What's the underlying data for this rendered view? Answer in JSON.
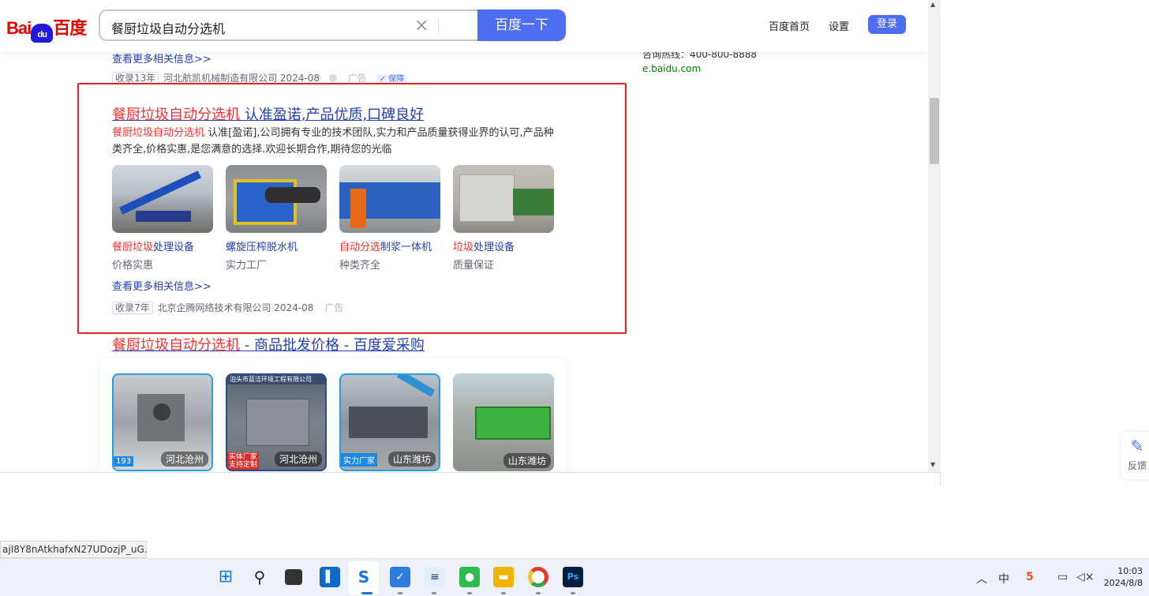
{
  "header": {
    "logo_text_left": "Bai",
    "logo_paw": "du",
    "logo_text_right": "百度",
    "search_query": "餐厨垃圾自动分选机",
    "search_button": "百度一下",
    "nav_home": "百度首页",
    "nav_settings": "设置",
    "login": "登录"
  },
  "prev_result": {
    "more_link": "查看更多相关信息>>",
    "tag": "收录13年",
    "company": "河北航凯机械制造有限公司 2024-08",
    "ad": "广告",
    "protect": "保障"
  },
  "right_column": {
    "hotline": "咨询热线：400-800-8888",
    "site": "e.baidu.com"
  },
  "ad_result": {
    "title_hl": "餐厨垃圾自动分选机",
    "title_rest": " 认准盈诺,产品优质,口碑良好",
    "desc_hl": "餐厨垃圾自动分选机",
    "desc_rest": " 认准[盈诺],公司拥有专业的技术团队,实力和产品质量获得业界的认可,产品种类齐全,价格实惠,是您满意的选择.欢迎长期合作,期待您的光临",
    "items": [
      {
        "title_hl": "餐厨垃圾",
        "title_rest": "处理设备",
        "sub": "价格实惠"
      },
      {
        "title_hl": "",
        "title_rest": "螺旋压榨脱水机",
        "sub": "实力工厂"
      },
      {
        "title_hl": "自动分选",
        "title_rest": "制浆一体机",
        "sub": "种类齐全"
      },
      {
        "title_hl": "垃圾",
        "title_rest": "处理设备",
        "sub": "质量保证"
      }
    ],
    "more_link": "查看更多相关信息>>",
    "tag": "收录7年",
    "company": "北京企腾网络技术有限公司 2024-08",
    "ad": "广告"
  },
  "b2b_result": {
    "title_hl": "餐厨垃圾自动分选机",
    "title_rest": " - 商品批发价格 - 百度爱采购",
    "products": [
      {
        "location": "河北沧州",
        "band": "",
        "label": "193"
      },
      {
        "location": "河北沧州",
        "band": "泊头市蓝洁环境工程有限公司",
        "label": "实体厂家 支持定制"
      },
      {
        "location": "山东潍坊",
        "band": "",
        "label": "实力厂家"
      },
      {
        "location": "山东潍坊",
        "band": "",
        "label": ""
      }
    ]
  },
  "feedback_label": "反馈",
  "status_url": "ajI8Y8nAtkhafxN27UDozjP_uG...",
  "taskbar": {
    "time": "10:03",
    "date": "2024/8/8",
    "ime": "中"
  },
  "colors": {
    "brand_blue": "#4e6ef2",
    "link_blue": "#2440b3",
    "highlight_red": "#f73131",
    "box_red": "#ee2222"
  }
}
